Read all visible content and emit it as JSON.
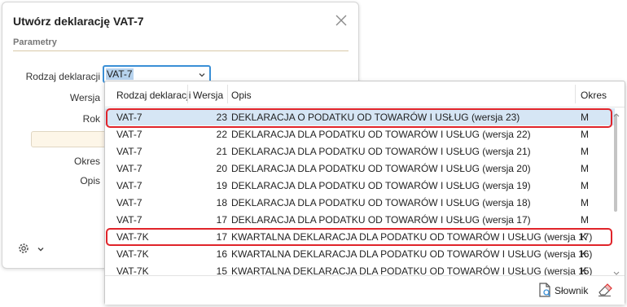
{
  "dialog": {
    "title": "Utwórz deklarację VAT-7",
    "section": "Parametry",
    "fields": {
      "rodzaj_label": "Rodzaj deklaracji",
      "rodzaj_value": "VAT-7",
      "wersja_label": "Wersja",
      "rok_label": "Rok",
      "okres_label": "Okres",
      "opis_label": "Opis"
    }
  },
  "dropdown": {
    "headers": {
      "rodzaj": "Rodzaj deklaracji",
      "wersja": "Wersja",
      "opis": "Opis",
      "okres": "Okres"
    },
    "rows": [
      {
        "rodzaj": "VAT-7",
        "wersja": "23",
        "opis": "DEKLARACJA O PODATKU OD TOWARÓW I USŁUG (wersja 23)",
        "okres": "M"
      },
      {
        "rodzaj": "VAT-7",
        "wersja": "22",
        "opis": "DEKLARACJA DLA PODATKU OD TOWARÓW I USŁUG (wersja 22)",
        "okres": "M"
      },
      {
        "rodzaj": "VAT-7",
        "wersja": "21",
        "opis": "DEKLARACJA DLA PODATKU OD TOWARÓW I USŁUG (wersja 21)",
        "okres": "M"
      },
      {
        "rodzaj": "VAT-7",
        "wersja": "20",
        "opis": "DEKLARACJA DLA PODATKU OD TOWARÓW I USŁUG (wersja 20)",
        "okres": "M"
      },
      {
        "rodzaj": "VAT-7",
        "wersja": "19",
        "opis": "DEKLARACJA DLA PODATKU OD TOWARÓW I USŁUG (wersja 19)",
        "okres": "M"
      },
      {
        "rodzaj": "VAT-7",
        "wersja": "18",
        "opis": "DEKLARACJA DLA PODATKU OD TOWARÓW I USŁUG (wersja 18)",
        "okres": "M"
      },
      {
        "rodzaj": "VAT-7",
        "wersja": "17",
        "opis": "DEKLARACJA DLA PODATKU OD TOWARÓW I USŁUG (wersja 17)",
        "okres": "M"
      },
      {
        "rodzaj": "VAT-7K",
        "wersja": "17",
        "opis": "KWARTALNA DEKLARACJA DLA PODATKU OD TOWARÓW I USŁUG (wersja 17)",
        "okres": "K"
      },
      {
        "rodzaj": "VAT-7K",
        "wersja": "16",
        "opis": "KWARTALNA DEKLARACJA DLA PODATKU OD TOWARÓW I USŁUG (wersja 16)",
        "okres": "K"
      },
      {
        "rodzaj": "VAT-7K",
        "wersja": "15",
        "opis": "KWARTALNA DEKLARACJA DLA PODATKU OD TOWARÓW I USŁUG (wersja 15)",
        "okres": "K"
      }
    ],
    "selected_index": 0,
    "highlighted_rows": [
      0,
      7
    ],
    "footer": {
      "slownik_label": "Słownik"
    }
  },
  "icons": {
    "close": "close-icon",
    "combo_chevron": "chevron-down-icon",
    "settings": "gear-icon",
    "slownik": "document-icon",
    "clear": "eraser-icon"
  },
  "colors": {
    "accent": "#3a8fd6",
    "selection": "#d6e6f5",
    "highlight_annotation": "#e0242a"
  }
}
